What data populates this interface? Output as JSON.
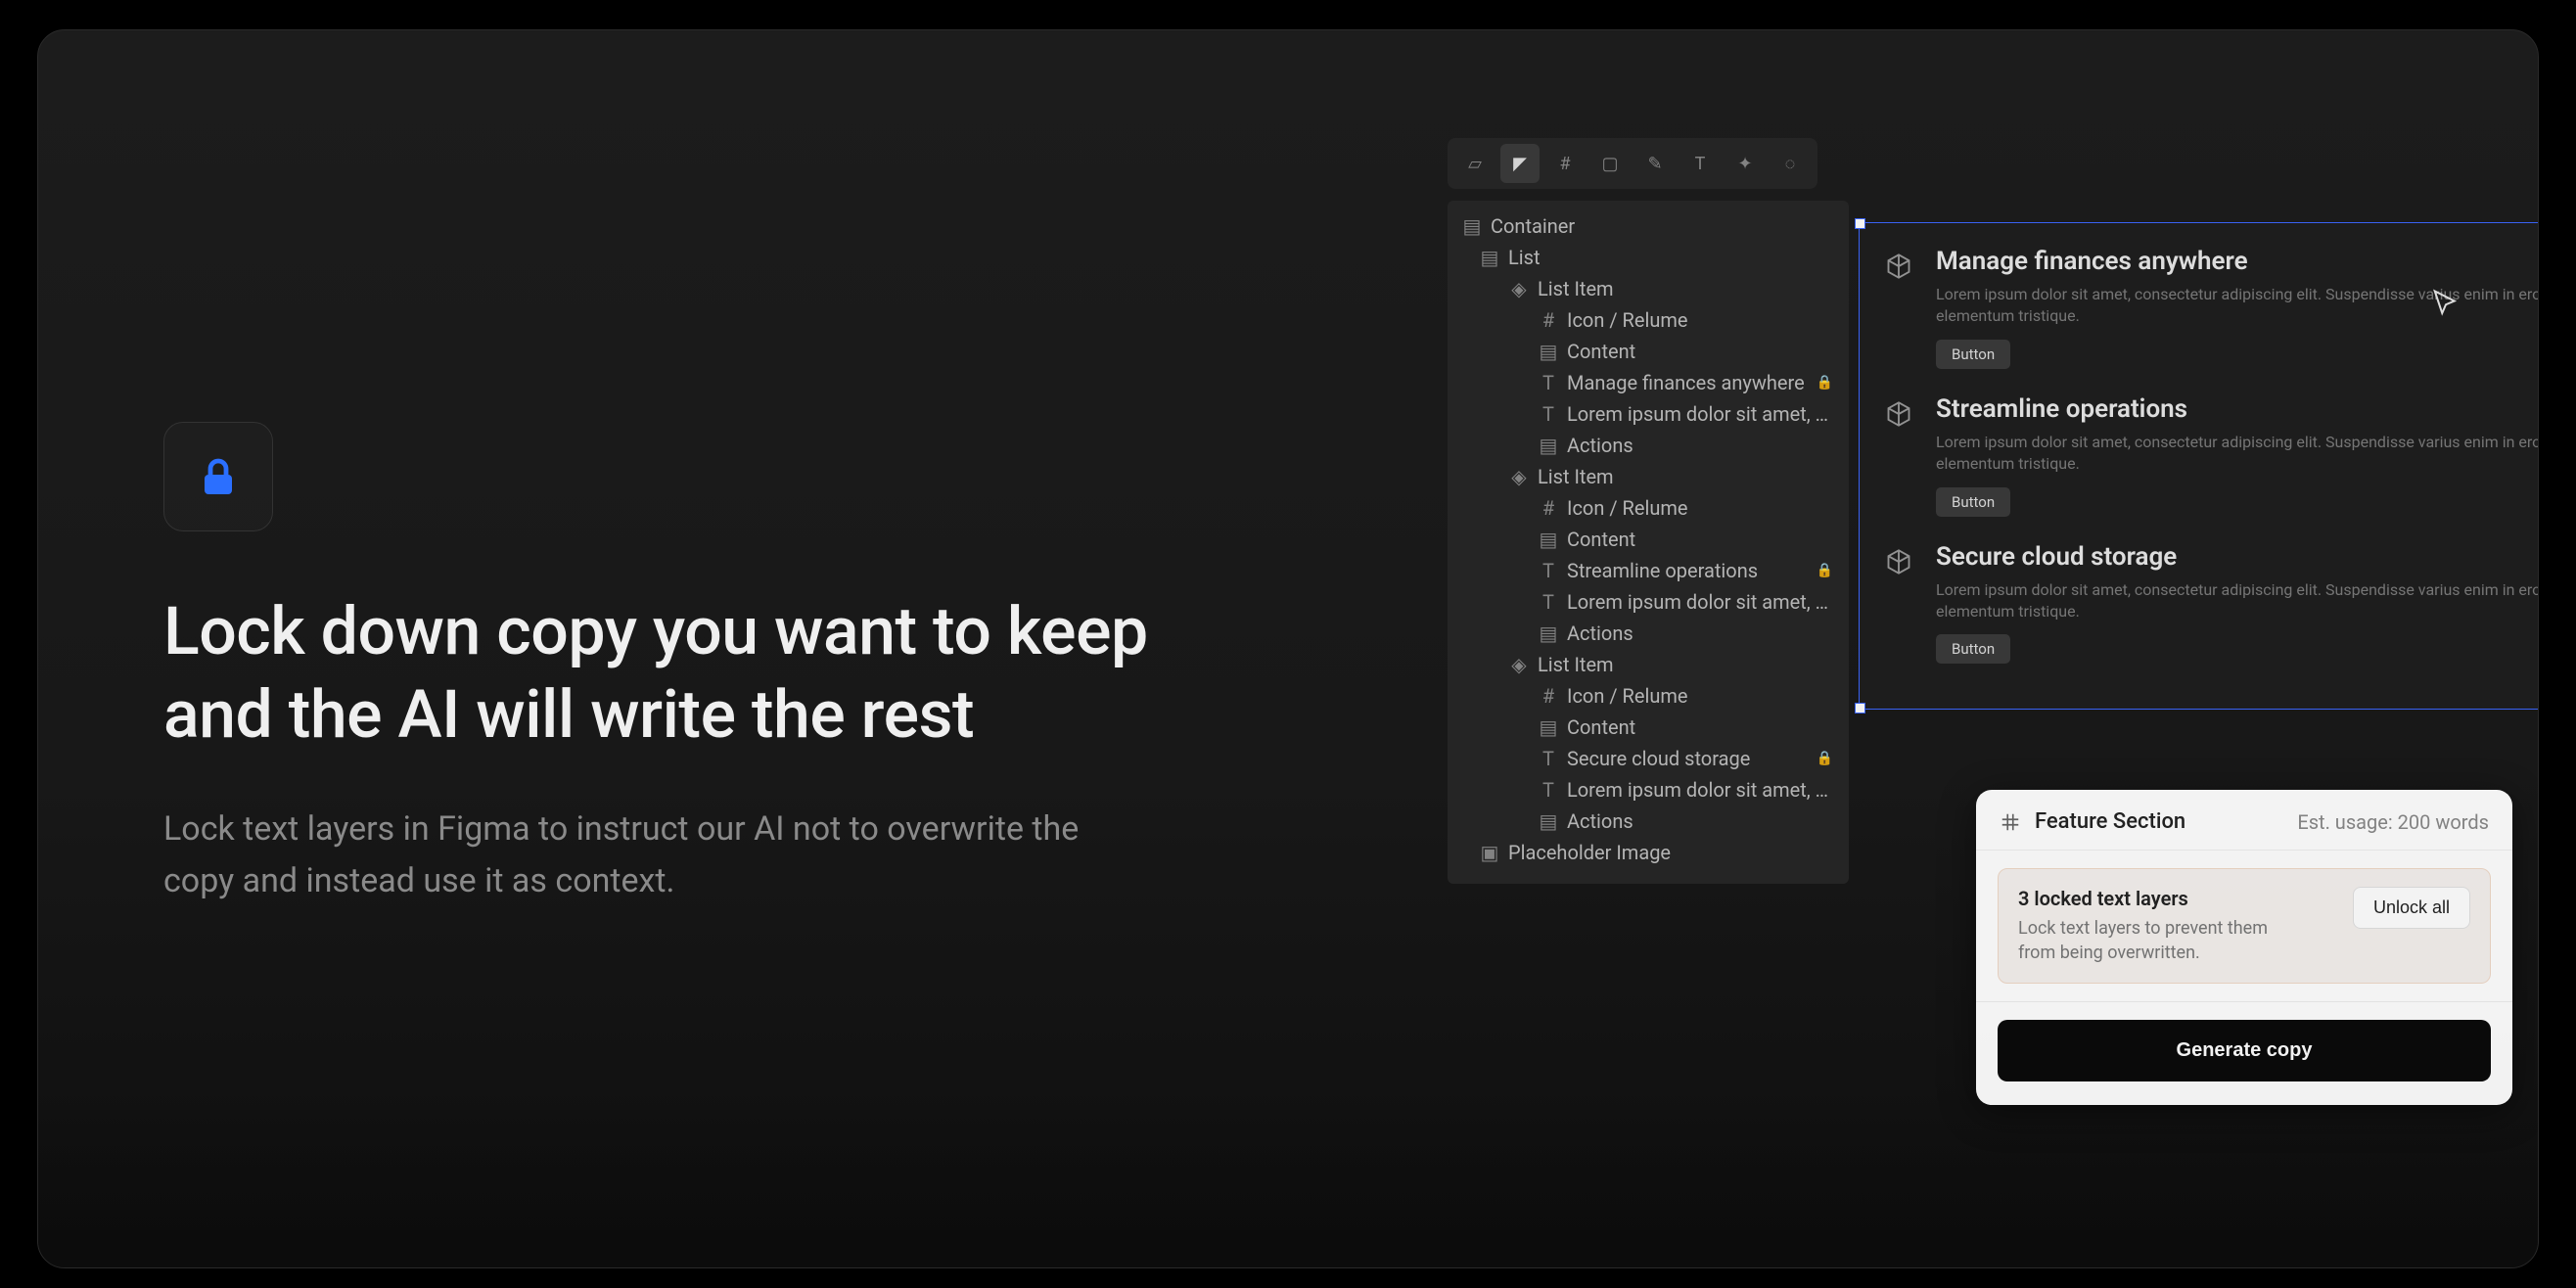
{
  "hero": {
    "headline": "Lock down copy you want to keep and the AI will write the rest",
    "subcopy": "Lock text layers in Figma to instruct our AI not to overwrite the copy and instead use it as context."
  },
  "layers": {
    "root": "Container",
    "items": [
      {
        "type": "frame",
        "label": "List",
        "indent": 1
      },
      {
        "type": "component",
        "label": "List Item",
        "indent": 2
      },
      {
        "type": "frame-hash",
        "label": "Icon / Relume",
        "indent": 3
      },
      {
        "type": "frame",
        "label": "Content",
        "indent": 3
      },
      {
        "type": "text",
        "label": "Manage finances anywhere",
        "indent": 3,
        "locked": true
      },
      {
        "type": "text",
        "label": "Lorem ipsum dolor sit amet, conse…",
        "indent": 3
      },
      {
        "type": "frame",
        "label": "Actions",
        "indent": 3
      },
      {
        "type": "component",
        "label": "List Item",
        "indent": 2
      },
      {
        "type": "frame-hash",
        "label": "Icon / Relume",
        "indent": 3
      },
      {
        "type": "frame",
        "label": "Content",
        "indent": 3
      },
      {
        "type": "text",
        "label": "Streamline operations",
        "indent": 3,
        "locked": true
      },
      {
        "type": "text",
        "label": "Lorem ipsum dolor sit amet, conse…",
        "indent": 3
      },
      {
        "type": "frame",
        "label": "Actions",
        "indent": 3
      },
      {
        "type": "component",
        "label": "List Item",
        "indent": 2
      },
      {
        "type": "frame-hash",
        "label": "Icon / Relume",
        "indent": 3
      },
      {
        "type": "frame",
        "label": "Content",
        "indent": 3
      },
      {
        "type": "text",
        "label": "Secure cloud storage",
        "indent": 3,
        "locked": true
      },
      {
        "type": "text",
        "label": "Lorem ipsum dolor sit amet, conse…",
        "indent": 3
      },
      {
        "type": "frame",
        "label": "Actions",
        "indent": 3
      },
      {
        "type": "image",
        "label": "Placeholder Image",
        "indent": 1
      }
    ]
  },
  "canvas": {
    "features": [
      {
        "title": "Manage finances anywhere",
        "desc": "Lorem ipsum dolor sit amet, consectetur adipiscing elit. Suspendisse varius enim in eros elementum tristique.",
        "button": "Button"
      },
      {
        "title": "Streamline operations",
        "desc": "Lorem ipsum dolor sit amet, consectetur adipiscing elit. Suspendisse varius enim in eros elementum tristique.",
        "button": "Button"
      },
      {
        "title": "Secure cloud storage",
        "desc": "Lorem ipsum dolor sit amet, consectetur adipiscing elit. Suspendisse varius enim in eros elementum tristique.",
        "button": "Button"
      }
    ]
  },
  "popup": {
    "title": "Feature Section",
    "usage": "Est. usage: 200 words",
    "locked_title": "3 locked text layers",
    "locked_desc": "Lock text layers to prevent them from being overwritten.",
    "unlock": "Unlock all",
    "generate": "Generate copy"
  }
}
